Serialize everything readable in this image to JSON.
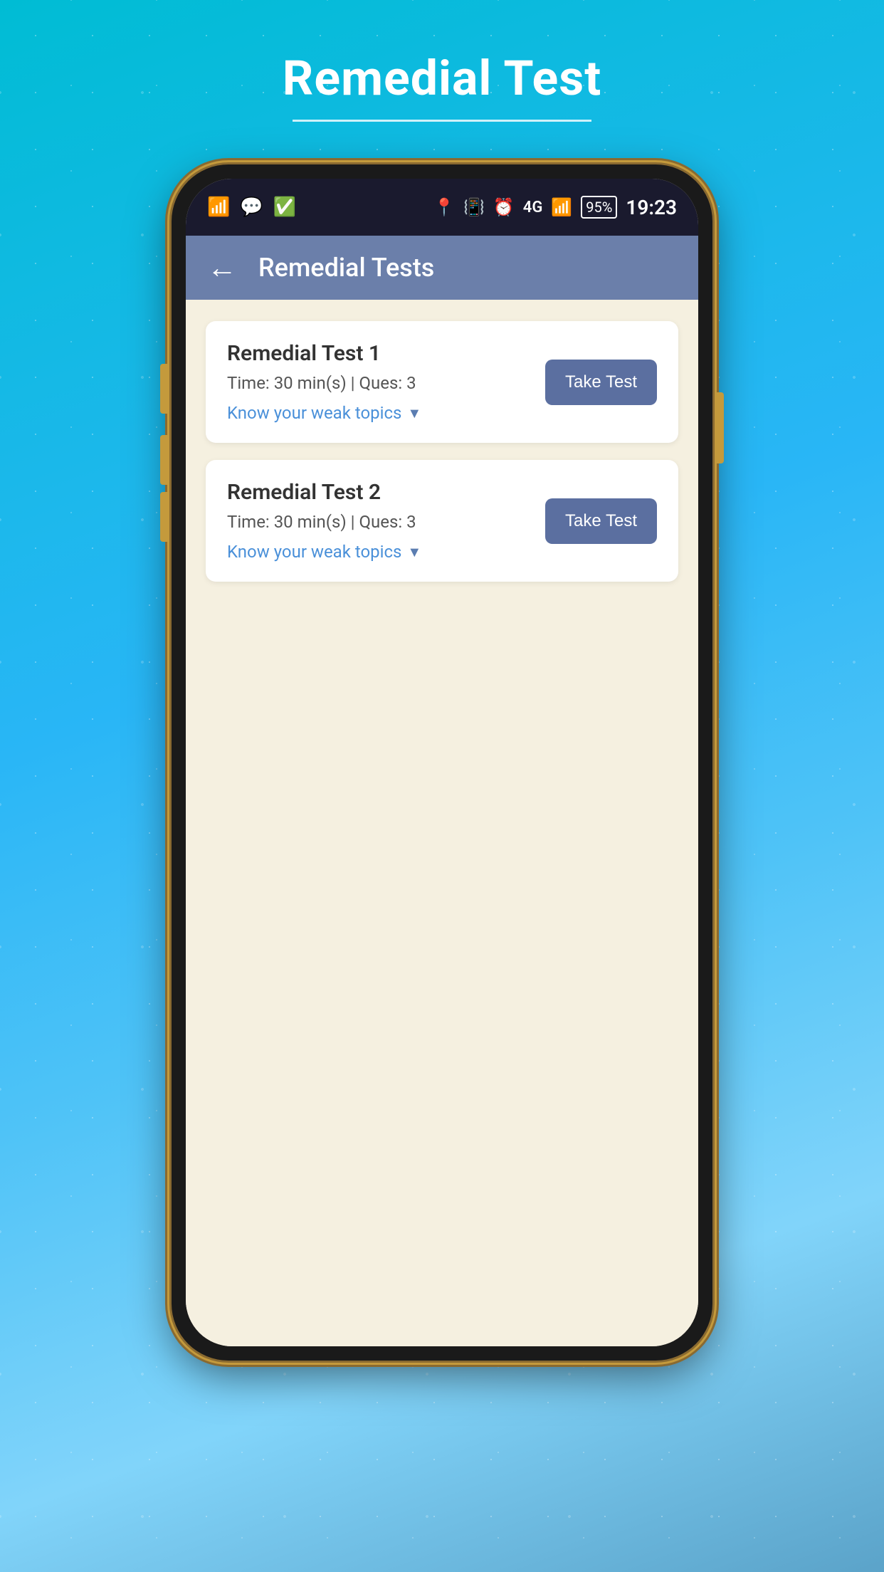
{
  "page": {
    "title": "Remedial Test",
    "title_underline": true
  },
  "status_bar": {
    "time": "19:23",
    "battery": "95%",
    "signal": "4G",
    "battery_icon": "🔋",
    "icons_left": [
      "📶",
      "💬",
      "✅"
    ],
    "icons_right": [
      "📍",
      "📳",
      "⏰",
      "4G",
      "📶"
    ]
  },
  "header": {
    "back_label": "←",
    "title": "Remedial Tests"
  },
  "tests": [
    {
      "id": 1,
      "name": "Remedial Test 1",
      "meta": "Time: 30 min(s) | Ques: 3",
      "weak_topics_label": "Know your weak topics",
      "take_test_label": "Take Test"
    },
    {
      "id": 2,
      "name": "Remedial Test 2",
      "meta": "Time: 30 min(s) | Ques: 3",
      "weak_topics_label": "Know your weak topics",
      "take_test_label": "Take Test"
    }
  ],
  "colors": {
    "header_bg": "#6b7faa",
    "btn_bg": "#5b6fa0",
    "content_bg": "#f5f0e0",
    "link_color": "#4a90d9",
    "card_bg": "#ffffff"
  }
}
